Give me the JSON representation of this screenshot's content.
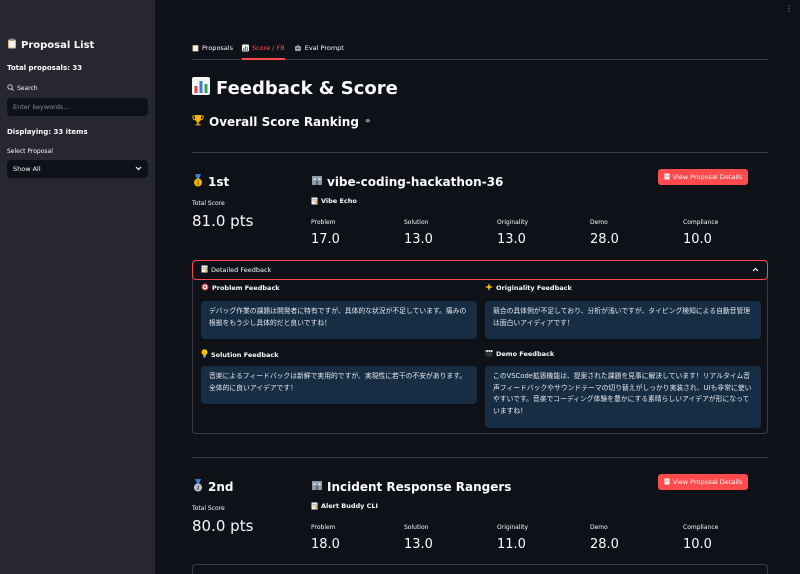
{
  "sidebar": {
    "title": "Proposal List",
    "total": "Total proposals: 33",
    "search_label": "Search",
    "search_placeholder": "Enter keywords...",
    "displaying": "Displaying: 33 items",
    "select_label": "Select Proposal",
    "select_value": "Show All"
  },
  "tabs": [
    {
      "label": "Proposals"
    },
    {
      "label": "Score / FB"
    },
    {
      "label": "Eval Prompt"
    }
  ],
  "page_title": "Feedback & Score",
  "section_title": "Overall Score Ranking",
  "total_score_label": "Total Score",
  "view_button_label": "View Proposal Details",
  "expander_label": "Detailed Feedback",
  "metric_labels": [
    "Problem",
    "Solution",
    "Originality",
    "Demo",
    "Compliance"
  ],
  "cards": [
    {
      "rank": "1st",
      "team": "vibe-coding-hackathon-36",
      "project": "Vibe Echo",
      "total": "81.0 pts",
      "metrics": [
        "17.0",
        "13.0",
        "13.0",
        "28.0",
        "10.0"
      ],
      "feedback": {
        "problem_title": "Problem Feedback",
        "problem_text": "デバッグ作業の課題は開発者に特有ですが、具体的な状況が不足しています。痛みの根拠をもう少し具体的だと良いですね！",
        "originality_title": "Originality Feedback",
        "originality_text": "競合の具体例が不足しており、分析が浅いですが、タイピング検知による自動音管理は面白いアイディアです！",
        "solution_title": "Solution Feedback",
        "solution_text": "音楽によるフィードバックは新鮮で実用的ですが、実現性に若干の不安があります。全体的に良いアイデアです！",
        "demo_title": "Demo Feedback",
        "demo_text": "このVSCode拡張機能は、提案された課題を見事に解決しています！リアルタイム音声フィードバックやサウンドテーマの切り替えがしっかり実装され、UIも非常に使いやすいです。音楽でコーディング体験を豊かにする素晴らしいアイデアが形になっていますね！"
      }
    },
    {
      "rank": "2nd",
      "team": "Incident Response Rangers",
      "project": "Alert Buddy CLI",
      "total": "80.0 pts",
      "metrics": [
        "18.0",
        "13.0",
        "11.0",
        "28.0",
        "10.0"
      ]
    }
  ],
  "colors": {
    "accent": "#ff4b4b",
    "background": "#0e1117",
    "sidebar": "#262730",
    "feedback_box": "#172d43"
  }
}
